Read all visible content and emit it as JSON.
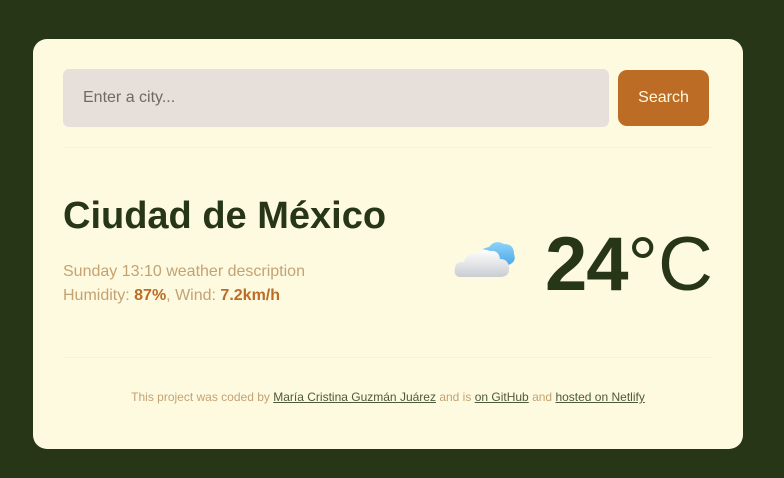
{
  "search": {
    "placeholder": "Enter a city...",
    "value": "",
    "button_label": "Search"
  },
  "weather": {
    "city": "Ciudad de México",
    "day": "Sunday",
    "time": "13:10",
    "description": "weather description",
    "humidity_label": "Humidity:",
    "humidity_value": "87%",
    "wind_label": "Wind:",
    "wind_value": "7.2km/h",
    "icon": "cloud-icon",
    "temperature": "24",
    "unit": "°C"
  },
  "footer": {
    "prefix": "This project was coded by",
    "author": "María Cristina Guzmán Juárez",
    "middle": "and is",
    "github_link": "on GitHub",
    "and": "and",
    "netlify_link": "hosted on Netlify"
  },
  "colors": {
    "background": "#283618",
    "card": "#fefae0",
    "accent": "#bc6c25",
    "muted_text": "#c4a272",
    "input_bg": "#e6dfda"
  }
}
